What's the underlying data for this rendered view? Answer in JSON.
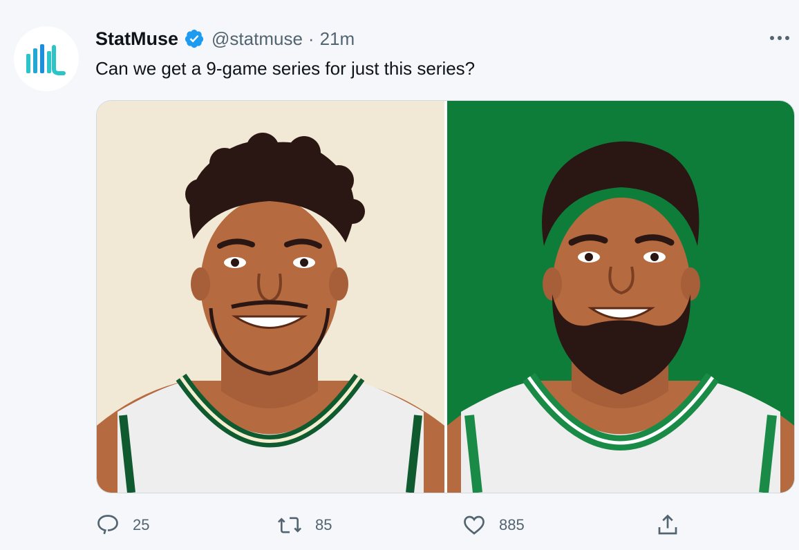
{
  "tweet": {
    "author_name": "StatMuse",
    "handle": "@statmuse",
    "separator": "·",
    "time": "21m",
    "text": "Can we get a 9-game series for just this series?"
  },
  "media": {
    "left_panel": {
      "background": "#f1e9d6",
      "jersey_trim": "#0f5a2e"
    },
    "right_panel": {
      "background": "#0f7d3a",
      "jersey_trim": "#1a8a47"
    }
  },
  "actions": {
    "reply_count": "25",
    "retweet_count": "85",
    "like_count": "885"
  },
  "colors": {
    "accent": "#1d9bf0",
    "brand": "#1fb6c9",
    "muted": "#536471"
  },
  "icons": {
    "reply": "reply-icon",
    "retweet": "retweet-icon",
    "like": "heart-icon",
    "share": "share-icon",
    "verified": "verified-badge-icon",
    "more": "more-options-icon"
  }
}
